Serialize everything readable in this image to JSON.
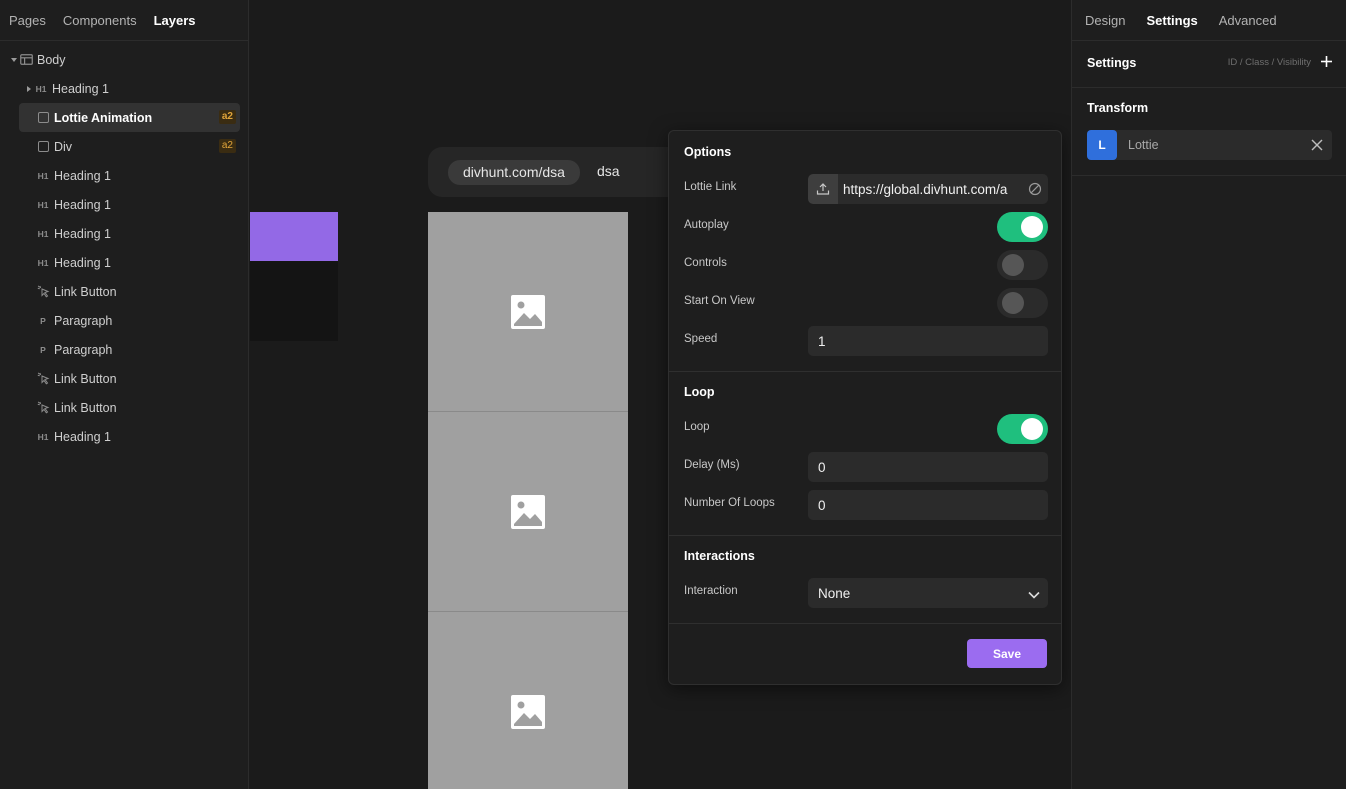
{
  "left_panel": {
    "tabs": [
      "Pages",
      "Components",
      "Layers"
    ],
    "active_tab": "Layers",
    "layers": [
      {
        "label": "Body",
        "icon": "body-layout-icon",
        "has_chevron": true,
        "chevron": "down"
      },
      {
        "label": "Heading 1",
        "icon": "h1-tag",
        "tag": "H1",
        "has_chevron": true,
        "chevron": "right"
      },
      {
        "label": "Lottie Animation",
        "icon": "box-icon",
        "badge": "a2",
        "selected": true
      },
      {
        "label": "Div",
        "icon": "box-icon",
        "badge": "a2"
      },
      {
        "label": "Heading 1",
        "icon": "h1-tag",
        "tag": "H1"
      },
      {
        "label": "Heading 1",
        "icon": "h1-tag",
        "tag": "H1"
      },
      {
        "label": "Heading 1",
        "icon": "h1-tag",
        "tag": "H1"
      },
      {
        "label": "Heading 1",
        "icon": "h1-tag",
        "tag": "H1"
      },
      {
        "label": "Link Button",
        "icon": "cursor-click-icon"
      },
      {
        "label": "Paragraph",
        "icon": "p-tag",
        "tag": "P"
      },
      {
        "label": "Paragraph",
        "icon": "p-tag",
        "tag": "P"
      },
      {
        "label": "Link Button",
        "icon": "cursor-click-icon"
      },
      {
        "label": "Link Button",
        "icon": "cursor-click-icon"
      },
      {
        "label": "Heading 1",
        "icon": "h1-tag",
        "tag": "H1"
      }
    ]
  },
  "canvas": {
    "url_chip": "divhunt.com/dsa",
    "url_text": "dsa",
    "image_placeholders": 3
  },
  "popover": {
    "options_title": "Options",
    "lottie_link_label": "Lottie Link",
    "lottie_link_value": "https://global.divhunt.com/a",
    "autoplay_label": "Autoplay",
    "autoplay_on": true,
    "controls_label": "Controls",
    "controls_on": false,
    "start_on_view_label": "Start On View",
    "start_on_view_on": false,
    "speed_label": "Speed",
    "speed_value": "1",
    "loop_title": "Loop",
    "loop_label": "Loop",
    "loop_on": true,
    "delay_label": "Delay (Ms)",
    "delay_value": "0",
    "loops_label": "Number Of Loops",
    "loops_value": "0",
    "interactions_title": "Interactions",
    "interaction_label": "Interaction",
    "interaction_value": "None",
    "save_label": "Save"
  },
  "right_panel": {
    "tabs": [
      "Design",
      "Settings",
      "Advanced"
    ],
    "active_tab": "Settings",
    "settings_title": "Settings",
    "settings_meta": "ID / Class / Visibility",
    "transform_title": "Transform",
    "transform_item_initial": "L",
    "transform_item_name": "Lottie"
  },
  "colors": {
    "accent_purple": "#9b6cf0",
    "toggle_on": "#1fbf7e",
    "badge_text": "#e0a43a",
    "avatar_blue": "#2f6fdc"
  }
}
